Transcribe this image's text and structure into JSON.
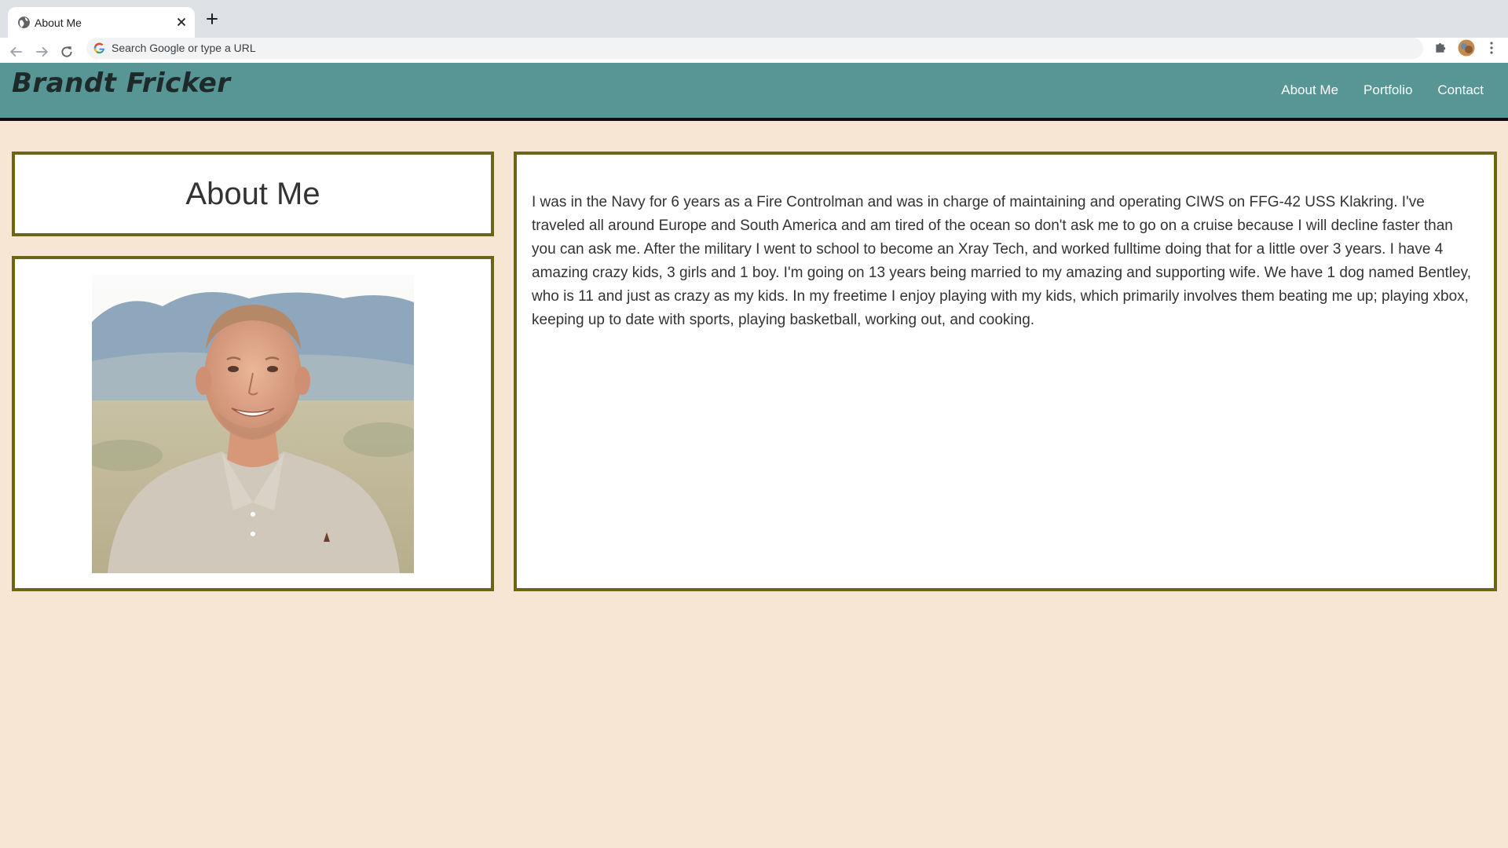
{
  "browser": {
    "tab_title": "About Me",
    "omnibox_placeholder": "Search Google or type a URL"
  },
  "site": {
    "brand": "Brandt Fricker",
    "nav": [
      {
        "label": "About Me"
      },
      {
        "label": "Portfolio"
      },
      {
        "label": "Contact"
      }
    ]
  },
  "about": {
    "heading": "About Me",
    "photo_alt": "Portrait of Brandt Fricker",
    "bio": "I was in the Navy for 6 years as a Fire Controlman and was in charge of maintaining and operating CIWS on FFG-42 USS Klakring. I've traveled all around Europe and South America and am tired of the ocean so don't ask me to go on a cruise because I will decline faster than you can ask me. After the military I went to school to become an Xray Tech, and worked fulltime doing that for a little over 3 years. I have 4 amazing crazy kids, 3 girls and 1 boy. I'm going on 13 years being married to my amazing and supporting wife. We have 1 dog named Bentley, who is 11 and just as crazy as my kids. In my freetime I enjoy playing with my kids, which primarily involves them beating me up; playing xbox, keeping up to date with sports, playing basketball, working out, and cooking."
  },
  "colors": {
    "page_background": "#f8e6d4",
    "header_background": "#589595",
    "card_border": "#6b6514"
  }
}
